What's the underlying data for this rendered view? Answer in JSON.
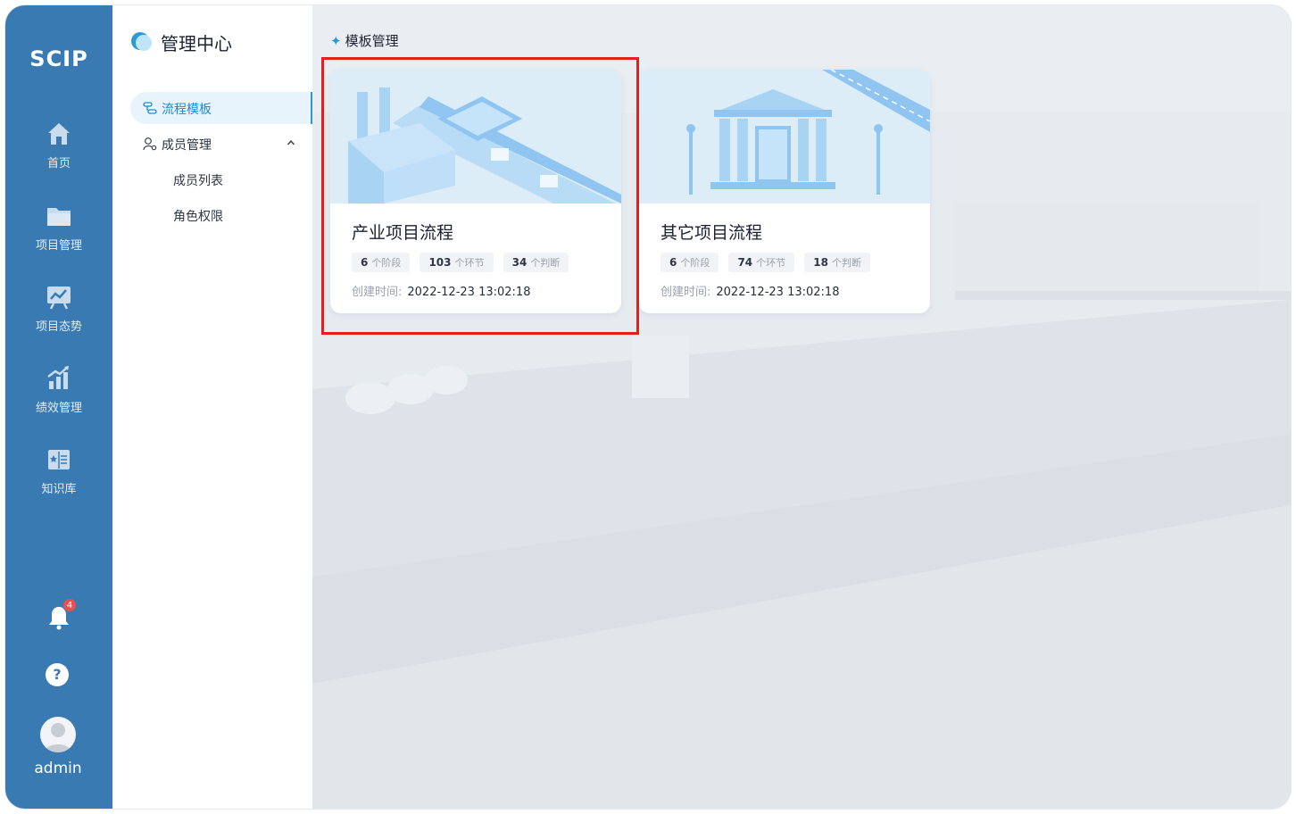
{
  "app": {
    "logo": "SCIP",
    "user": "admin",
    "notification_count": "4",
    "help_glyph": "?"
  },
  "rail": {
    "items": [
      {
        "label": "首页",
        "icon": "home-icon"
      },
      {
        "label": "项目管理",
        "icon": "folder-icon"
      },
      {
        "label": "项目态势",
        "icon": "trend-board-icon"
      },
      {
        "label": "绩效管理",
        "icon": "bar-growth-icon"
      },
      {
        "label": "知识库",
        "icon": "book-icon"
      }
    ]
  },
  "sidebar": {
    "title": "管理中心",
    "active_item": "流程模板",
    "group": "成员管理",
    "sub_items": [
      "成员列表",
      "角色权限"
    ]
  },
  "main": {
    "breadcrumb": "模板管理",
    "cards": [
      {
        "title": "产业项目流程",
        "stages": "6",
        "stages_label": "个阶段",
        "steps": "103",
        "steps_label": "个环节",
        "decisions": "34",
        "decisions_label": "个判断",
        "created_label": "创建时间:",
        "created_at": "2022-12-23 13:02:18",
        "selected": true
      },
      {
        "title": "其它项目流程",
        "stages": "6",
        "stages_label": "个阶段",
        "steps": "74",
        "steps_label": "个环节",
        "decisions": "18",
        "decisions_label": "个判断",
        "created_label": "创建时间:",
        "created_at": "2022-12-23 13:02:18",
        "selected": false
      }
    ]
  },
  "colors": {
    "rail": "#3a7ab3",
    "accent": "#2d9ad8",
    "highlight": "#e0201f",
    "badge": "#ef4e4e"
  }
}
